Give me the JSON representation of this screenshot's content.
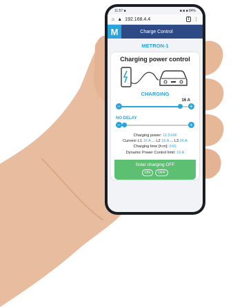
{
  "statusbar": {
    "left": "11:57 ■",
    "right": "■ ■ ■ 84%"
  },
  "browser": {
    "url": "192.168.4.4",
    "tab_count": "1"
  },
  "app": {
    "logo_letter": "M",
    "header_title": "Charge Control",
    "device_name": "METRON-1",
    "card_title": "Charging power control",
    "status_text": "CHARGING",
    "current_setting": "16 A",
    "current_slider_fraction": 0.9,
    "delay_label": "NO DELAY",
    "delay_slider_fraction": 0.0,
    "charging_power_label": "Charging power:",
    "charging_power_value": "11.0 kW",
    "current_label": "Current:",
    "l1_label": "L1",
    "l1_value": "16 A",
    "l2_label": "L2",
    "l2_value": "16 A",
    "l3_label": "L3",
    "l3_value": "16 A",
    "dots": "...",
    "charging_time_label": "Charging time [h:m]:",
    "charging_time_value": "0:01",
    "dpc_label": "Dynamic Power Control limit:",
    "dpc_value": "16 A",
    "solar_label": "Solar charging OFF",
    "solar_on": "ON",
    "solar_off": "OFF"
  },
  "colors": {
    "accent": "#2aa3df",
    "header": "#2e4a86",
    "solar": "#5cbf72"
  },
  "icons": [
    "home-icon",
    "lock-icon",
    "tab-switcher-icon",
    "menu-icon",
    "ev-charger-icon",
    "car-icon",
    "minus-icon",
    "plus-icon"
  ]
}
